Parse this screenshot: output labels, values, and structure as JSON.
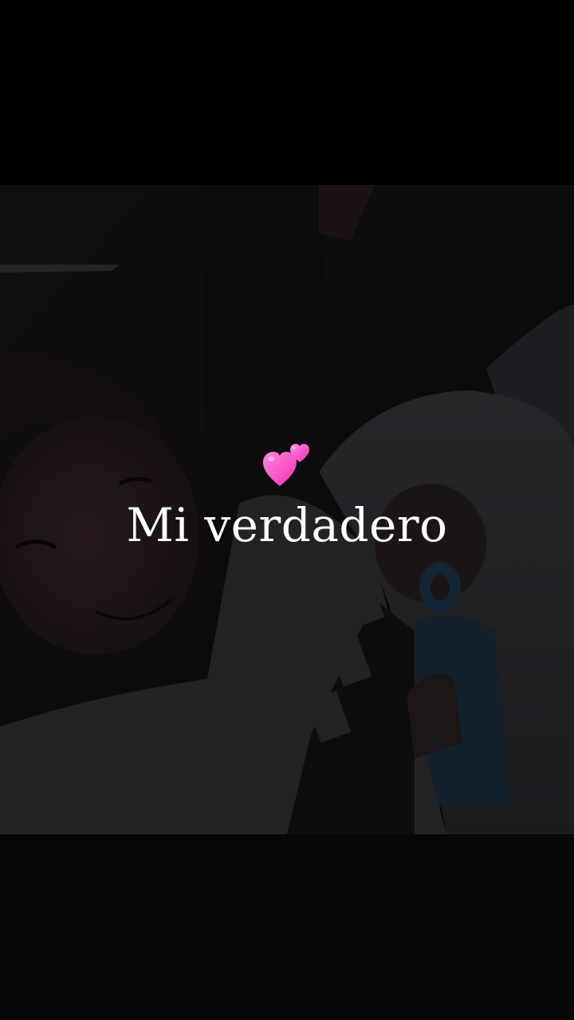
{
  "story": {
    "caption": "Mi verdadero",
    "sticker_icon": "two-hearts-icon",
    "sticker_color": "#ff4fc8",
    "caption_color": "#ffffff",
    "background_color": "#000000"
  }
}
